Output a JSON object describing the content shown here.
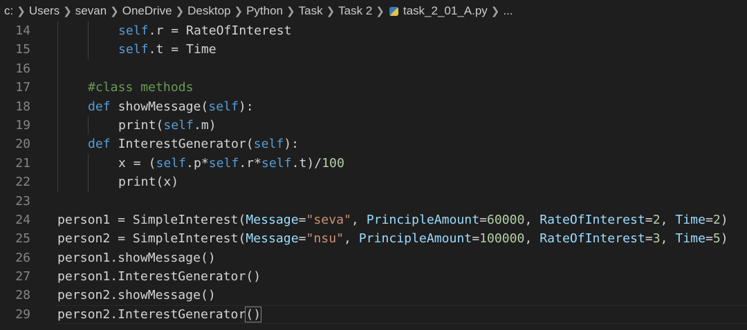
{
  "breadcrumb": [
    "c:",
    "Users",
    "sevan",
    "OneDrive",
    "Desktop",
    "Python",
    "Task",
    "Task 2",
    "task_2_01_A.py",
    "..."
  ],
  "breadcrumb_file_icon": "python-icon",
  "lines": [
    {
      "n": "14",
      "indent": 2,
      "tokens": [
        [
          "kw",
          "self"
        ],
        [
          "plain",
          ".r = RateOfInterest"
        ]
      ]
    },
    {
      "n": "15",
      "indent": 2,
      "tokens": [
        [
          "kw",
          "self"
        ],
        [
          "plain",
          ".t = Time"
        ]
      ]
    },
    {
      "n": "16",
      "indent": 1,
      "tokens": []
    },
    {
      "n": "17",
      "indent": 1,
      "tokens": [
        [
          "cm",
          "#class methods"
        ]
      ]
    },
    {
      "n": "18",
      "indent": 1,
      "tokens": [
        [
          "kw",
          "def"
        ],
        [
          "plain",
          " showMessage("
        ],
        [
          "kw",
          "self"
        ],
        [
          "plain",
          "):"
        ]
      ]
    },
    {
      "n": "19",
      "indent": 2,
      "tokens": [
        [
          "plain",
          "print("
        ],
        [
          "kw",
          "self"
        ],
        [
          "plain",
          ".m)"
        ]
      ]
    },
    {
      "n": "20",
      "indent": 1,
      "tokens": [
        [
          "kw",
          "def"
        ],
        [
          "plain",
          " InterestGenerator("
        ],
        [
          "kw",
          "self"
        ],
        [
          "plain",
          "):"
        ]
      ]
    },
    {
      "n": "21",
      "indent": 2,
      "tokens": [
        [
          "plain",
          "x = ("
        ],
        [
          "kw",
          "self"
        ],
        [
          "plain",
          ".p*"
        ],
        [
          "kw",
          "self"
        ],
        [
          "plain",
          ".r*"
        ],
        [
          "kw",
          "self"
        ],
        [
          "plain",
          ".t)/"
        ],
        [
          "num",
          "100"
        ]
      ]
    },
    {
      "n": "22",
      "indent": 2,
      "tokens": [
        [
          "plain",
          "print(x)"
        ]
      ]
    },
    {
      "n": "23",
      "indent": 0,
      "tokens": []
    },
    {
      "n": "24",
      "indent": 0,
      "tokens": [
        [
          "plain",
          "person1 = SimpleInterest("
        ],
        [
          "param",
          "Message"
        ],
        [
          "plain",
          "="
        ],
        [
          "str",
          "\"seva\""
        ],
        [
          "plain",
          ", "
        ],
        [
          "param",
          "PrincipleAmount"
        ],
        [
          "plain",
          "="
        ],
        [
          "num",
          "60000"
        ],
        [
          "plain",
          ", "
        ],
        [
          "param",
          "RateOfInterest"
        ],
        [
          "plain",
          "="
        ],
        [
          "num",
          "2"
        ],
        [
          "plain",
          ", "
        ],
        [
          "param",
          "Time"
        ],
        [
          "plain",
          "="
        ],
        [
          "num",
          "2"
        ],
        [
          "plain",
          ")"
        ]
      ]
    },
    {
      "n": "25",
      "indent": 0,
      "tokens": [
        [
          "plain",
          "person2 = SimpleInterest("
        ],
        [
          "param",
          "Message"
        ],
        [
          "plain",
          "="
        ],
        [
          "str",
          "\"nsu\""
        ],
        [
          "plain",
          ", "
        ],
        [
          "param",
          "PrincipleAmount"
        ],
        [
          "plain",
          "="
        ],
        [
          "num",
          "100000"
        ],
        [
          "plain",
          ", "
        ],
        [
          "param",
          "RateOfInterest"
        ],
        [
          "plain",
          "="
        ],
        [
          "num",
          "3"
        ],
        [
          "plain",
          ", "
        ],
        [
          "param",
          "Time"
        ],
        [
          "plain",
          "="
        ],
        [
          "num",
          "5"
        ],
        [
          "plain",
          ")"
        ]
      ]
    },
    {
      "n": "26",
      "indent": 0,
      "tokens": [
        [
          "plain",
          "person1.showMessage()"
        ]
      ]
    },
    {
      "n": "27",
      "indent": 0,
      "tokens": [
        [
          "plain",
          "person1.InterestGenerator()"
        ]
      ]
    },
    {
      "n": "28",
      "indent": 0,
      "tokens": [
        [
          "plain",
          "person2.showMessage()"
        ]
      ]
    },
    {
      "n": "29",
      "indent": 0,
      "current": true,
      "tokens": [
        [
          "plain",
          "person2.InterestGenerator"
        ],
        [
          "bm",
          "()"
        ]
      ]
    }
  ]
}
